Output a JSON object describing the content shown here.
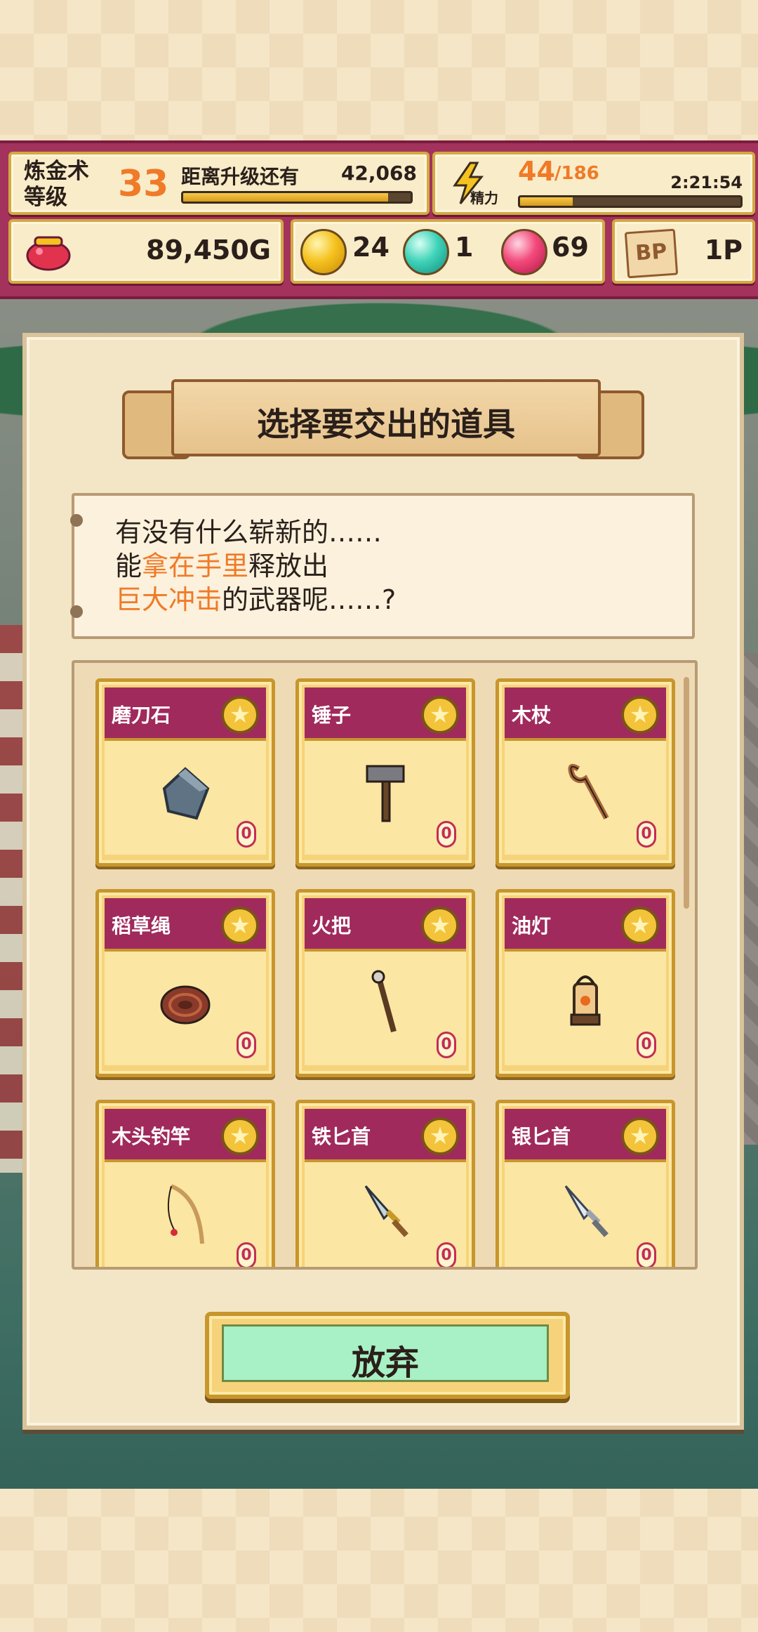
{
  "hud": {
    "level_label": "炼金术等级",
    "level_value": "33",
    "up_label": "距离升级还有",
    "up_value": "42,068",
    "level_progress": 0.9,
    "energy_sub": "精力",
    "energy_current": "44",
    "energy_max": "/186",
    "energy_timer": "2:21:54",
    "energy_progress": 0.24,
    "gold": "89,450G",
    "gem_yellow": "24",
    "gem_cyan": "1",
    "gem_pink": "69",
    "bp_icon_text": "BP",
    "bp": "1P"
  },
  "modal": {
    "title": "选择要交出的道具",
    "dialog_line1": "有没有什么崭新的……",
    "dialog_line2_pre": "能",
    "dialog_line2_hl": "拿在手里",
    "dialog_line2_post": "释放出",
    "dialog_line3_hl": "巨大冲击",
    "dialog_line3_post": "的武器呢……?",
    "give_up": "放弃"
  },
  "items": [
    {
      "name": "磨刀石",
      "count": "0",
      "icon": "whetstone-icon"
    },
    {
      "name": "锤子",
      "count": "0",
      "icon": "hammer-icon"
    },
    {
      "name": "木杖",
      "count": "0",
      "icon": "wooden-staff-icon"
    },
    {
      "name": "稻草绳",
      "count": "0",
      "icon": "straw-rope-icon"
    },
    {
      "name": "火把",
      "count": "0",
      "icon": "torch-icon"
    },
    {
      "name": "油灯",
      "count": "0",
      "icon": "oil-lamp-icon"
    },
    {
      "name": "木头钓竿",
      "count": "0",
      "icon": "fishing-rod-icon"
    },
    {
      "name": "铁匕首",
      "count": "0",
      "icon": "iron-dagger-icon"
    },
    {
      "name": "银匕首",
      "count": "0",
      "icon": "silver-dagger-icon"
    }
  ],
  "colors": {
    "accent_orange": "#f07a27",
    "card_header": "#a02a5c",
    "button_green": "#a8f0c5"
  }
}
